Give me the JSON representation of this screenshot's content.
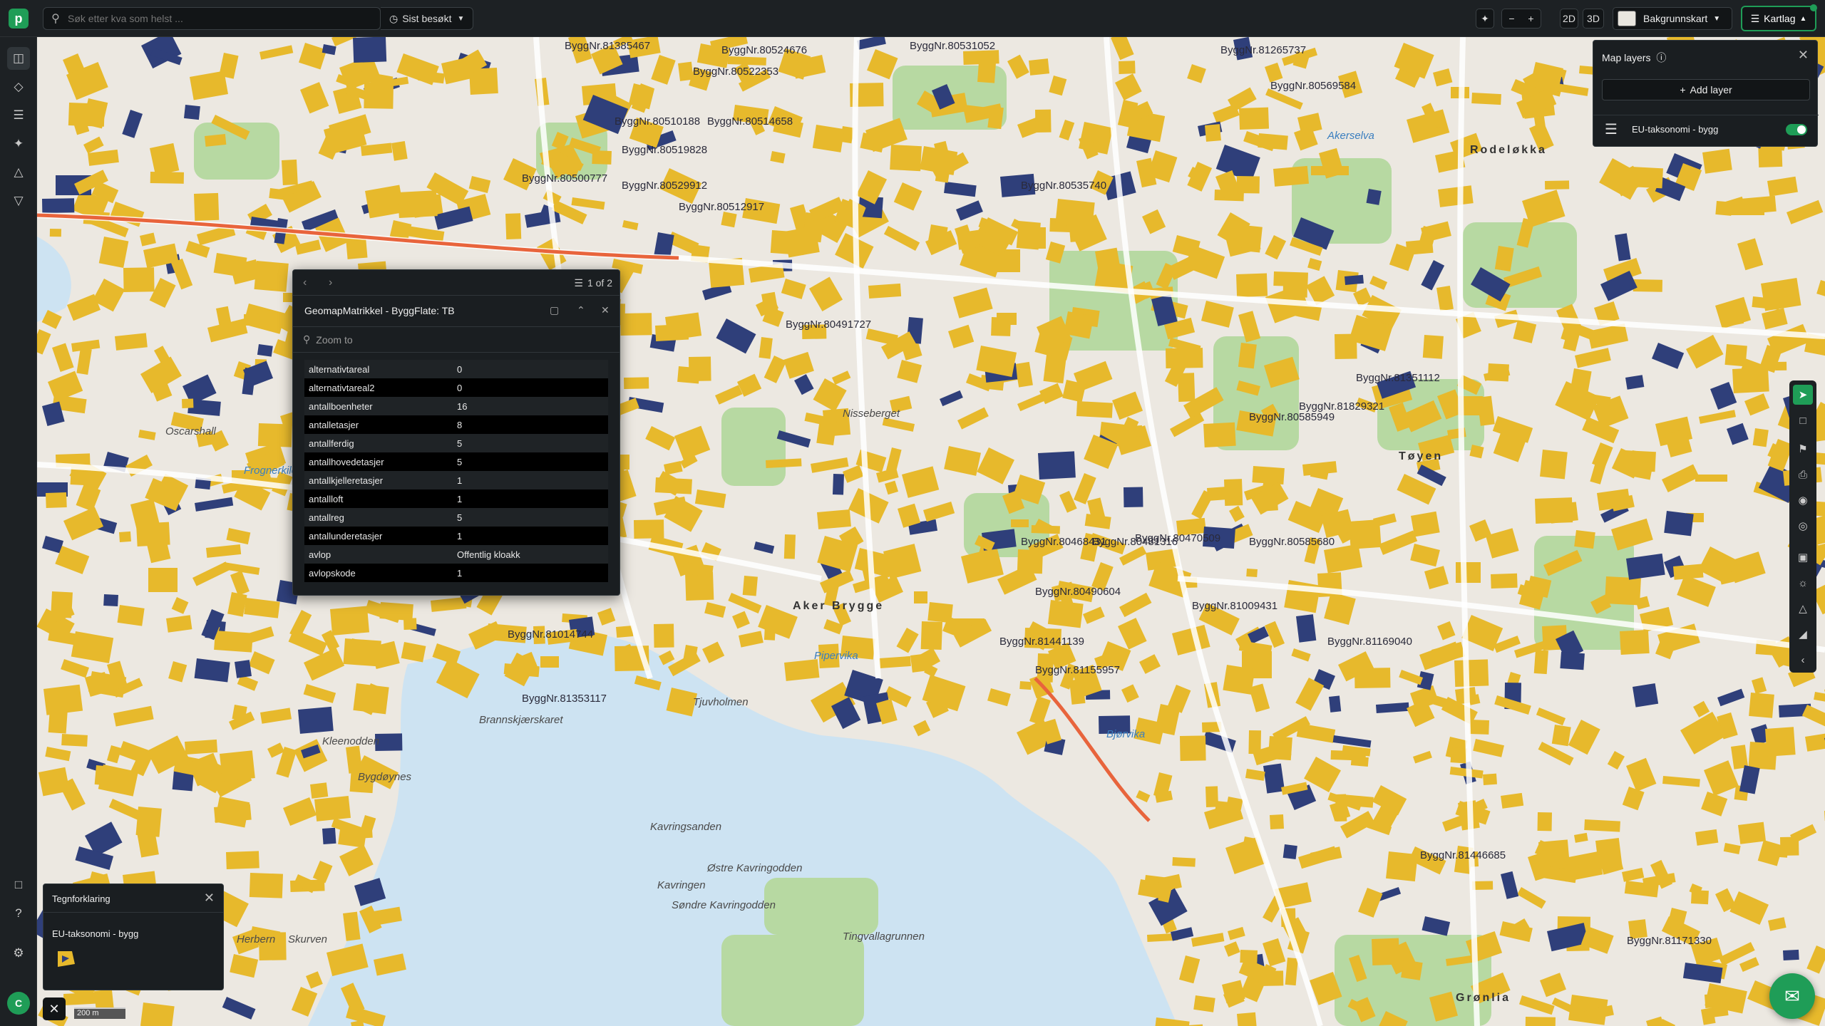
{
  "topbar": {
    "search_placeholder": "Søk etter kva som helst ...",
    "recent_label": "Sist besøkt",
    "view_2d": "2D",
    "view_3d": "3D",
    "basemap_label": "Bakgrunnskart",
    "layers_label": "Kartlag"
  },
  "sidebar": {
    "avatar_initial": "C"
  },
  "popup": {
    "pager": "1 of 2",
    "title": "GeomapMatrikkel - ByggFlate: TB",
    "zoom_placeholder": "Zoom to",
    "rows": [
      {
        "key": "alternativtareal",
        "value": "0"
      },
      {
        "key": "alternativtareal2",
        "value": "0"
      },
      {
        "key": "antallboenheter",
        "value": "16"
      },
      {
        "key": "antalletasjer",
        "value": "8"
      },
      {
        "key": "antallferdig",
        "value": "5"
      },
      {
        "key": "antallhovedetasjer",
        "value": "5"
      },
      {
        "key": "antallkjelleretasjer",
        "value": "1"
      },
      {
        "key": "antallloft",
        "value": "1"
      },
      {
        "key": "antallreg",
        "value": "5"
      },
      {
        "key": "antallunderetasjer",
        "value": "1"
      },
      {
        "key": "avlop",
        "value": "Offentlig kloakk"
      },
      {
        "key": "avlopskode",
        "value": "1"
      }
    ]
  },
  "layers_panel": {
    "title": "Map layers",
    "add_label": "Add layer",
    "layer_name": "EU-taksonomi - bygg"
  },
  "legend": {
    "title": "Tegnforklaring",
    "layer_name": "EU-taksonomi - bygg"
  },
  "scale": {
    "label": "200 m"
  },
  "map": {
    "places": [
      "Rodeløkka",
      "Aker Brygge",
      "Grønlia",
      "Tøyen",
      "Kavringsanden",
      "Pipervika",
      "Bjørvika",
      "Akerselva",
      "Frognerkilen",
      "Tjuvholmen",
      "Kavringen",
      "Østre Kavringodden",
      "Søndre Kavringodden",
      "Tingvallagrunnen",
      "Herbern",
      "Skurven",
      "Bygdøynes",
      "Kleenodden",
      "Nisseberget",
      "Oscarshall",
      "Brannskjærskaret"
    ],
    "building_labels": [
      "ByggNr.81385467",
      "ByggNr.80524676",
      "ByggNr.80531052",
      "ByggNr.81265737",
      "ByggNr.80569584",
      "ByggNr.80522353",
      "ByggNr.80514658",
      "ByggNr.80510188",
      "ByggNr.80529912",
      "ByggNr.80535740",
      "ByggNr.80491727",
      "ByggNr.81829321",
      "ByggNr.80585949",
      "ByggNr.80481316",
      "ByggNr.80490604",
      "ByggNr.81441139",
      "ByggNr.80468431",
      "ByggNr.81155957",
      "ByggNr.80519828",
      "ByggNr.81351112",
      "ByggNr.80470509",
      "ByggNr.80500777",
      "ByggNr.81014744",
      "ByggNr.81353117",
      "ByggNr.80585680",
      "ByggNr.81169040",
      "ByggNr.81446685",
      "ByggNr.81009431",
      "ByggNr.81171330",
      "ByggNr.80512917"
    ],
    "colors": {
      "building_yellow": "#e7b92c",
      "building_blue": "#2f3f7a",
      "park_green": "#b7d9a2",
      "water_blue": "#cde3f2",
      "accent_green": "#1f9d57"
    }
  }
}
